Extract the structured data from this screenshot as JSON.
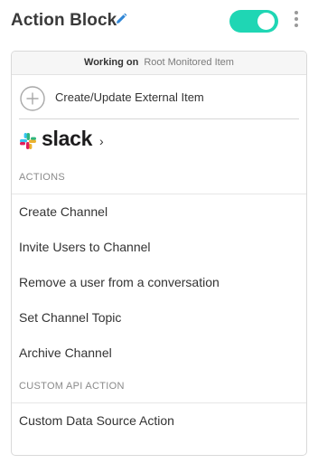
{
  "header": {
    "title": "Action Block",
    "toggle_on": true
  },
  "colors": {
    "toggle": "#1fd6b4",
    "pencil": "#2f86d6"
  },
  "context": {
    "label": "Working on",
    "value": "Root Monitored Item"
  },
  "create": {
    "label": "Create/Update External Item",
    "icon": "plus-circle-icon"
  },
  "integration": {
    "name": "slack",
    "icon": "slack-logo"
  },
  "sections": [
    {
      "title": "ACTIONS",
      "items": [
        "Create Channel",
        "Invite Users to Channel",
        "Remove a user from a conversation",
        "Set Channel Topic",
        "Archive Channel"
      ]
    },
    {
      "title": "CUSTOM API ACTION",
      "items": [
        "Custom Data Source Action"
      ]
    }
  ]
}
